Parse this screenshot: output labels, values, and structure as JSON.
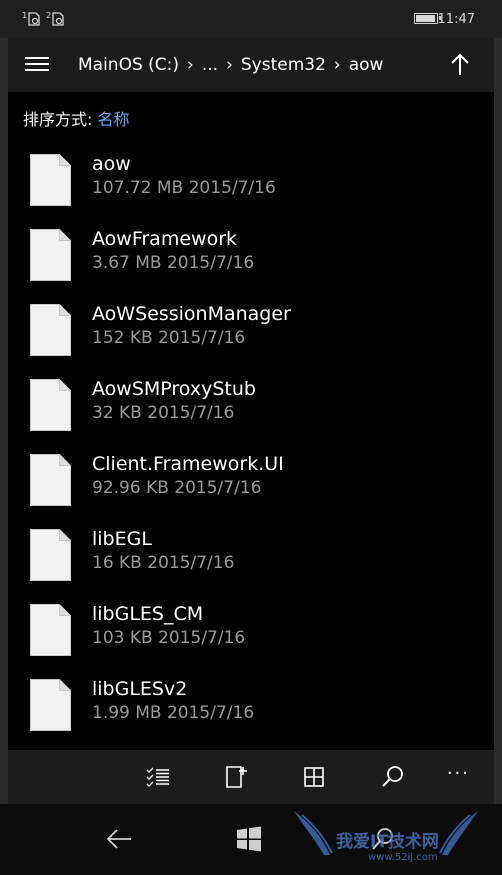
{
  "status": {
    "sim1": "1",
    "sim2": "2",
    "time": "11:47"
  },
  "breadcrumb": {
    "drive": "MainOS (C:)",
    "ellipsis": "...",
    "folder1": "System32",
    "folder2": "aow"
  },
  "sort": {
    "label": "排序方式:",
    "value": "名称"
  },
  "files": [
    {
      "name": "aow",
      "meta": "107.72 MB 2015/7/16"
    },
    {
      "name": "AowFramework",
      "meta": "3.67 MB 2015/7/16"
    },
    {
      "name": "AoWSessionManager",
      "meta": "152 KB 2015/7/16"
    },
    {
      "name": "AowSMProxyStub",
      "meta": "32 KB 2015/7/16"
    },
    {
      "name": "Client.Framework.UI",
      "meta": "92.96 KB 2015/7/16"
    },
    {
      "name": "libEGL",
      "meta": "16 KB 2015/7/16"
    },
    {
      "name": "libGLES_CM",
      "meta": "103 KB 2015/7/16"
    },
    {
      "name": "libGLESv2",
      "meta": "1.99 MB 2015/7/16"
    }
  ],
  "appbar": {
    "more": "···"
  },
  "watermark": {
    "text": "我爱IT技术网",
    "url": "www.52ij.com"
  },
  "colors": {
    "accent": "#66a8e6",
    "secondary_text": "#9a9a9a"
  }
}
